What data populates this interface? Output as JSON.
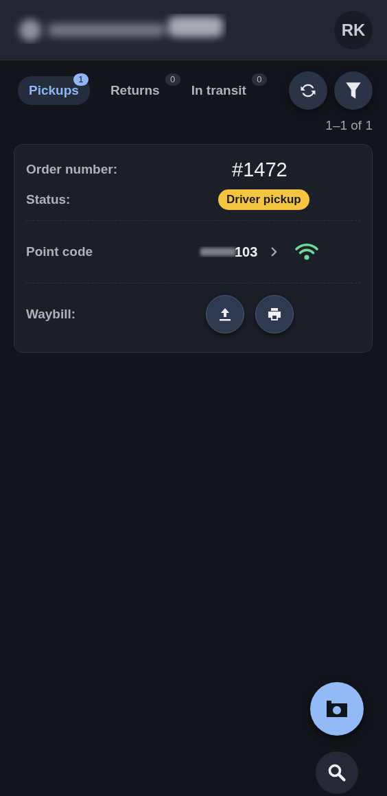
{
  "header": {
    "avatar": "RK"
  },
  "tabs": [
    {
      "label": "Pickups",
      "count": "1",
      "selected": true
    },
    {
      "label": "Returns",
      "count": "0",
      "selected": false
    },
    {
      "label": "In transit",
      "count": "0",
      "selected": false
    }
  ],
  "pagination": "1–1 of 1",
  "order": {
    "order_label": "Order number:",
    "order_number": "#1472",
    "status_label": "Status:",
    "status": "Driver pickup",
    "point_label": "Point code",
    "point_code": "103",
    "waybill_label": "Waybill:"
  }
}
